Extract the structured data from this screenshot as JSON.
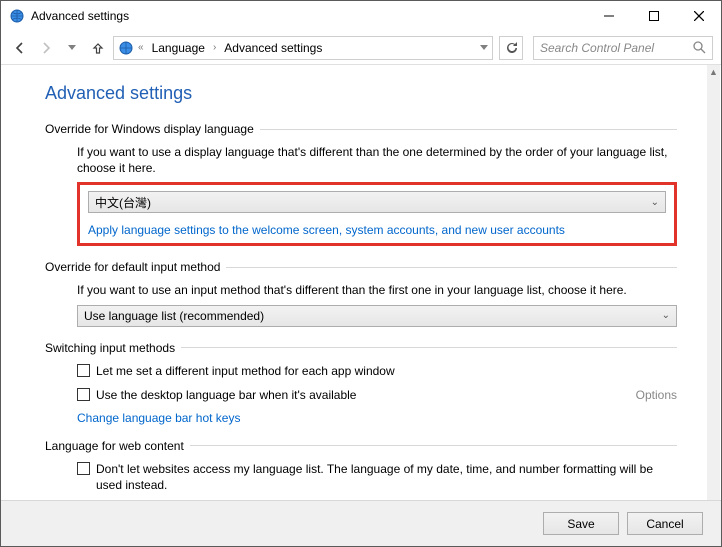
{
  "window": {
    "title": "Advanced settings"
  },
  "breadcrumb": {
    "sep_left": "«",
    "item1": "Language",
    "item2": "Advanced settings"
  },
  "search": {
    "placeholder": "Search Control Panel"
  },
  "page": {
    "title": "Advanced settings"
  },
  "group_display": {
    "header": "Override for Windows display language",
    "desc": "If you want to use a display language that's different than the one determined by the order of your language list, choose it here.",
    "selected": "中文(台灣)",
    "link": "Apply language settings to the welcome screen, system accounts, and new user accounts"
  },
  "group_input": {
    "header": "Override for default input method",
    "desc": "If you want to use an input method that's different than the first one in your language list, choose it here.",
    "selected": "Use language list (recommended)"
  },
  "group_switch": {
    "header": "Switching input methods",
    "check1": "Let me set a different input method for each app window",
    "check2": "Use the desktop language bar when it's available",
    "options": "Options",
    "link": "Change language bar hot keys"
  },
  "group_web": {
    "header": "Language for web content",
    "check1": "Don't let websites access my language list. The language of my date, time, and number formatting will be used instead."
  },
  "footer": {
    "save": "Save",
    "cancel": "Cancel"
  }
}
